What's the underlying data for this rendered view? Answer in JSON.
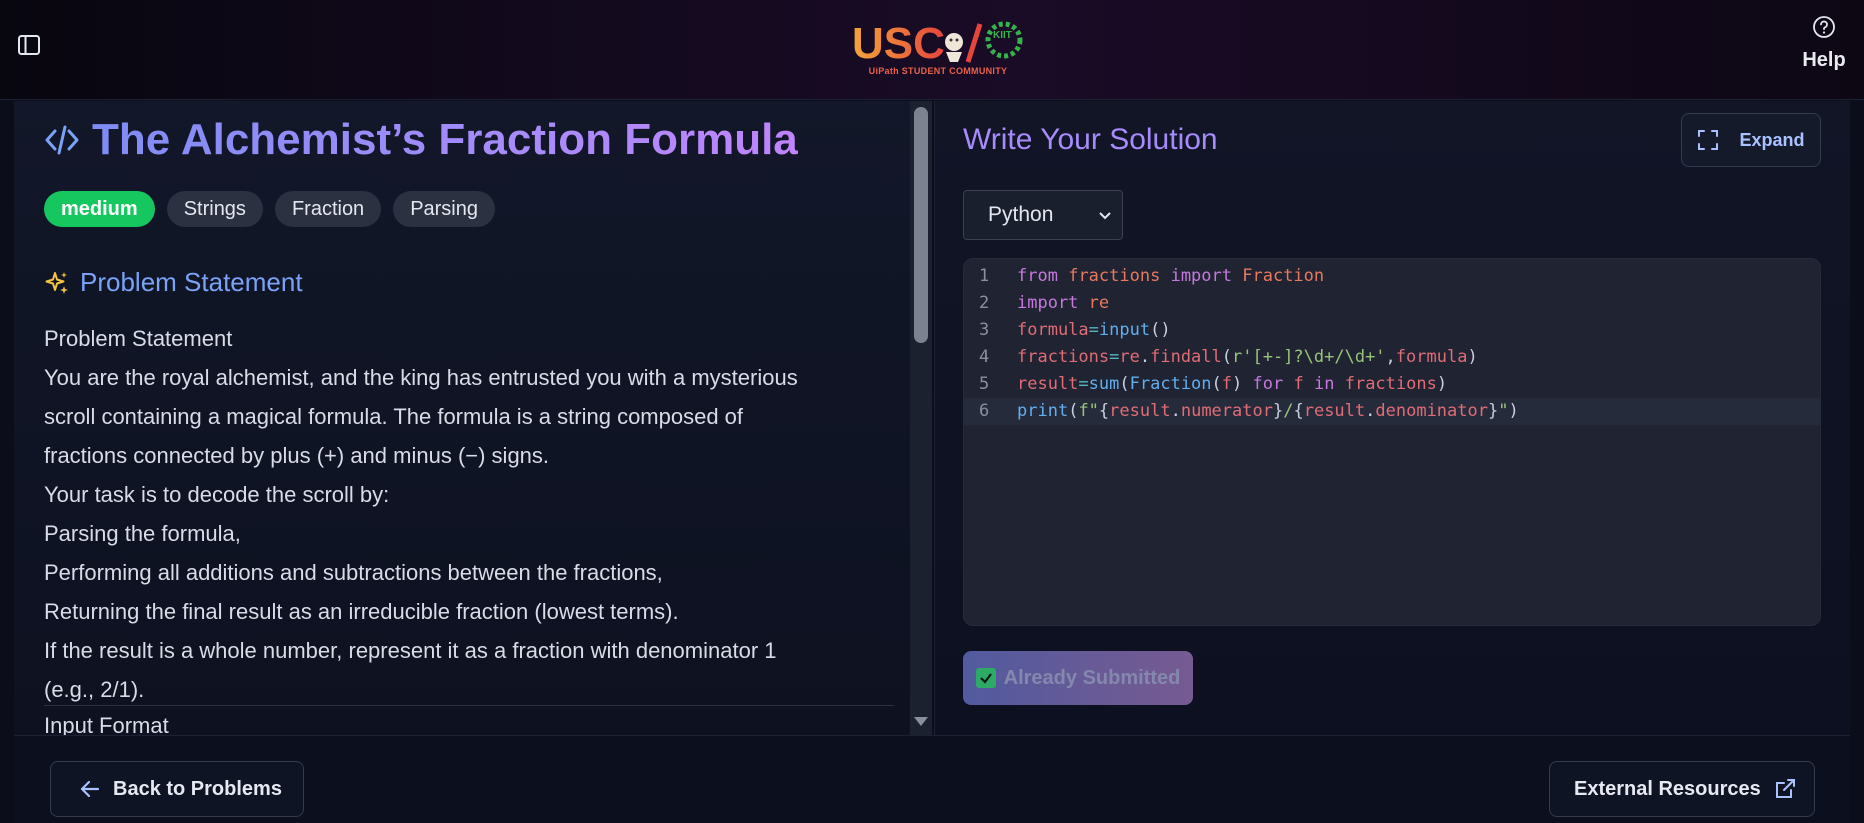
{
  "header": {
    "logo_text": "USC",
    "logo_badge": "KIIT",
    "logo_subtitle": "UiPath STUDENT COMMUNITY",
    "help_label": "Help"
  },
  "problem": {
    "title": "The Alchemist’s Fraction Formula",
    "tags": [
      "medium",
      "Strings",
      "Fraction",
      "Parsing"
    ],
    "section_heading": "Problem Statement",
    "statement_lines": [
      "Problem Statement",
      "You are the royal alchemist, and the king has entrusted you with a mysterious",
      "scroll containing a magical formula. The formula is a string composed of",
      "fractions connected by plus (+) and minus (−) signs.",
      "Your task is to decode the scroll by:",
      "Parsing the formula,",
      "Performing all additions and subtractions between the fractions,",
      "Returning the final result as an irreducible fraction (lowest terms).",
      "If the result is a whole number, represent it as a fraction with denominator 1",
      "(e.g., 2/1)."
    ],
    "next_section": "Input Format"
  },
  "editor_panel": {
    "title": "Write Your Solution",
    "expand_label": "Expand",
    "language": "Python",
    "line_numbers": [
      "1",
      "2",
      "3",
      "4",
      "5",
      "6"
    ],
    "code_lines": [
      "from fractions import Fraction",
      "import re",
      "formula=input()",
      "fractions=re.findall(r'[+-]?\\d+/\\d+',formula)",
      "result=sum(Fraction(f) for f in fractions)",
      "print(f\"{result.numerator}/{result.denominator}\")"
    ],
    "active_line": 6,
    "submit_label": "Already Submitted"
  },
  "footer": {
    "back_label": "Back to Problems",
    "external_label": "External Resources"
  },
  "colors": {
    "accent_purple": "#a78bfa",
    "accent_blue": "#7aa2f7",
    "tag_medium": "#16c75f",
    "background": "#0b0e1a"
  }
}
